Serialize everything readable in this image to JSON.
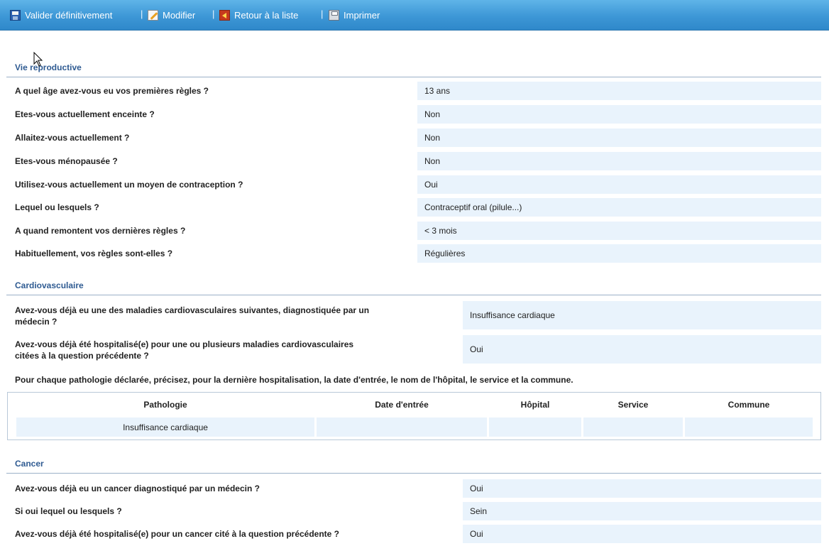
{
  "toolbar": {
    "validate_label": "Valider définitivement",
    "edit_label": "Modifier",
    "back_label": "Retour à la liste",
    "print_label": "Imprimer",
    "separator": "|"
  },
  "sections": {
    "reproductive": {
      "title": "Vie reproductive",
      "rows": [
        {
          "question": "A quel âge avez-vous eu vos premières règles ?",
          "answer": "13 ans"
        },
        {
          "question": "Etes-vous actuellement enceinte ?",
          "answer": "Non"
        },
        {
          "question": "Allaitez-vous actuellement ?",
          "answer": "Non"
        },
        {
          "question": "Etes-vous ménopausée ?",
          "answer": "Non"
        },
        {
          "question": "Utilisez-vous actuellement un moyen de contraception ?",
          "answer": "Oui"
        },
        {
          "question": "Lequel ou lesquels ?",
          "answer": "Contraceptif oral (pilule...)"
        },
        {
          "question": "A quand remontent vos dernières règles ?",
          "answer": "< 3 mois"
        },
        {
          "question": "Habituellement, vos règles sont-elles ?",
          "answer": "Régulières"
        }
      ]
    },
    "cardio": {
      "title": "Cardiovasculaire",
      "rows": [
        {
          "question_line1": "Avez-vous déjà eu une des maladies cardiovasculaires suivantes, diagnostiquée par un",
          "question_line2": "médecin ?",
          "answer": "Insuffisance cardiaque"
        },
        {
          "question_line1": "Avez-vous déjà été hospitalisé(e) pour une ou plusieurs maladies cardiovasculaires",
          "question_line2": "citées à la question précédente ?",
          "answer": "Oui"
        }
      ],
      "note": "Pour chaque pathologie déclarée, précisez, pour la dernière hospitalisation, la date d'entrée, le nom de l'hôpital, le service et la commune.",
      "table": {
        "headers": [
          "Pathologie",
          "Date d'entrée",
          "Hôpital",
          "Service",
          "Commune"
        ],
        "rows": [
          [
            "Insuffisance cardiaque",
            "",
            "",
            "",
            ""
          ]
        ]
      }
    },
    "cancer": {
      "title": "Cancer",
      "rows": [
        {
          "question": "Avez-vous déjà eu un cancer diagnostiqué par un médecin ?",
          "answer": "Oui"
        },
        {
          "question": "Si oui lequel ou lesquels ?",
          "answer": "Sein"
        },
        {
          "question": "Avez-vous déjà été hospitalisé(e) pour un cancer cité à la question précédente ?",
          "answer": "Oui"
        }
      ]
    }
  }
}
